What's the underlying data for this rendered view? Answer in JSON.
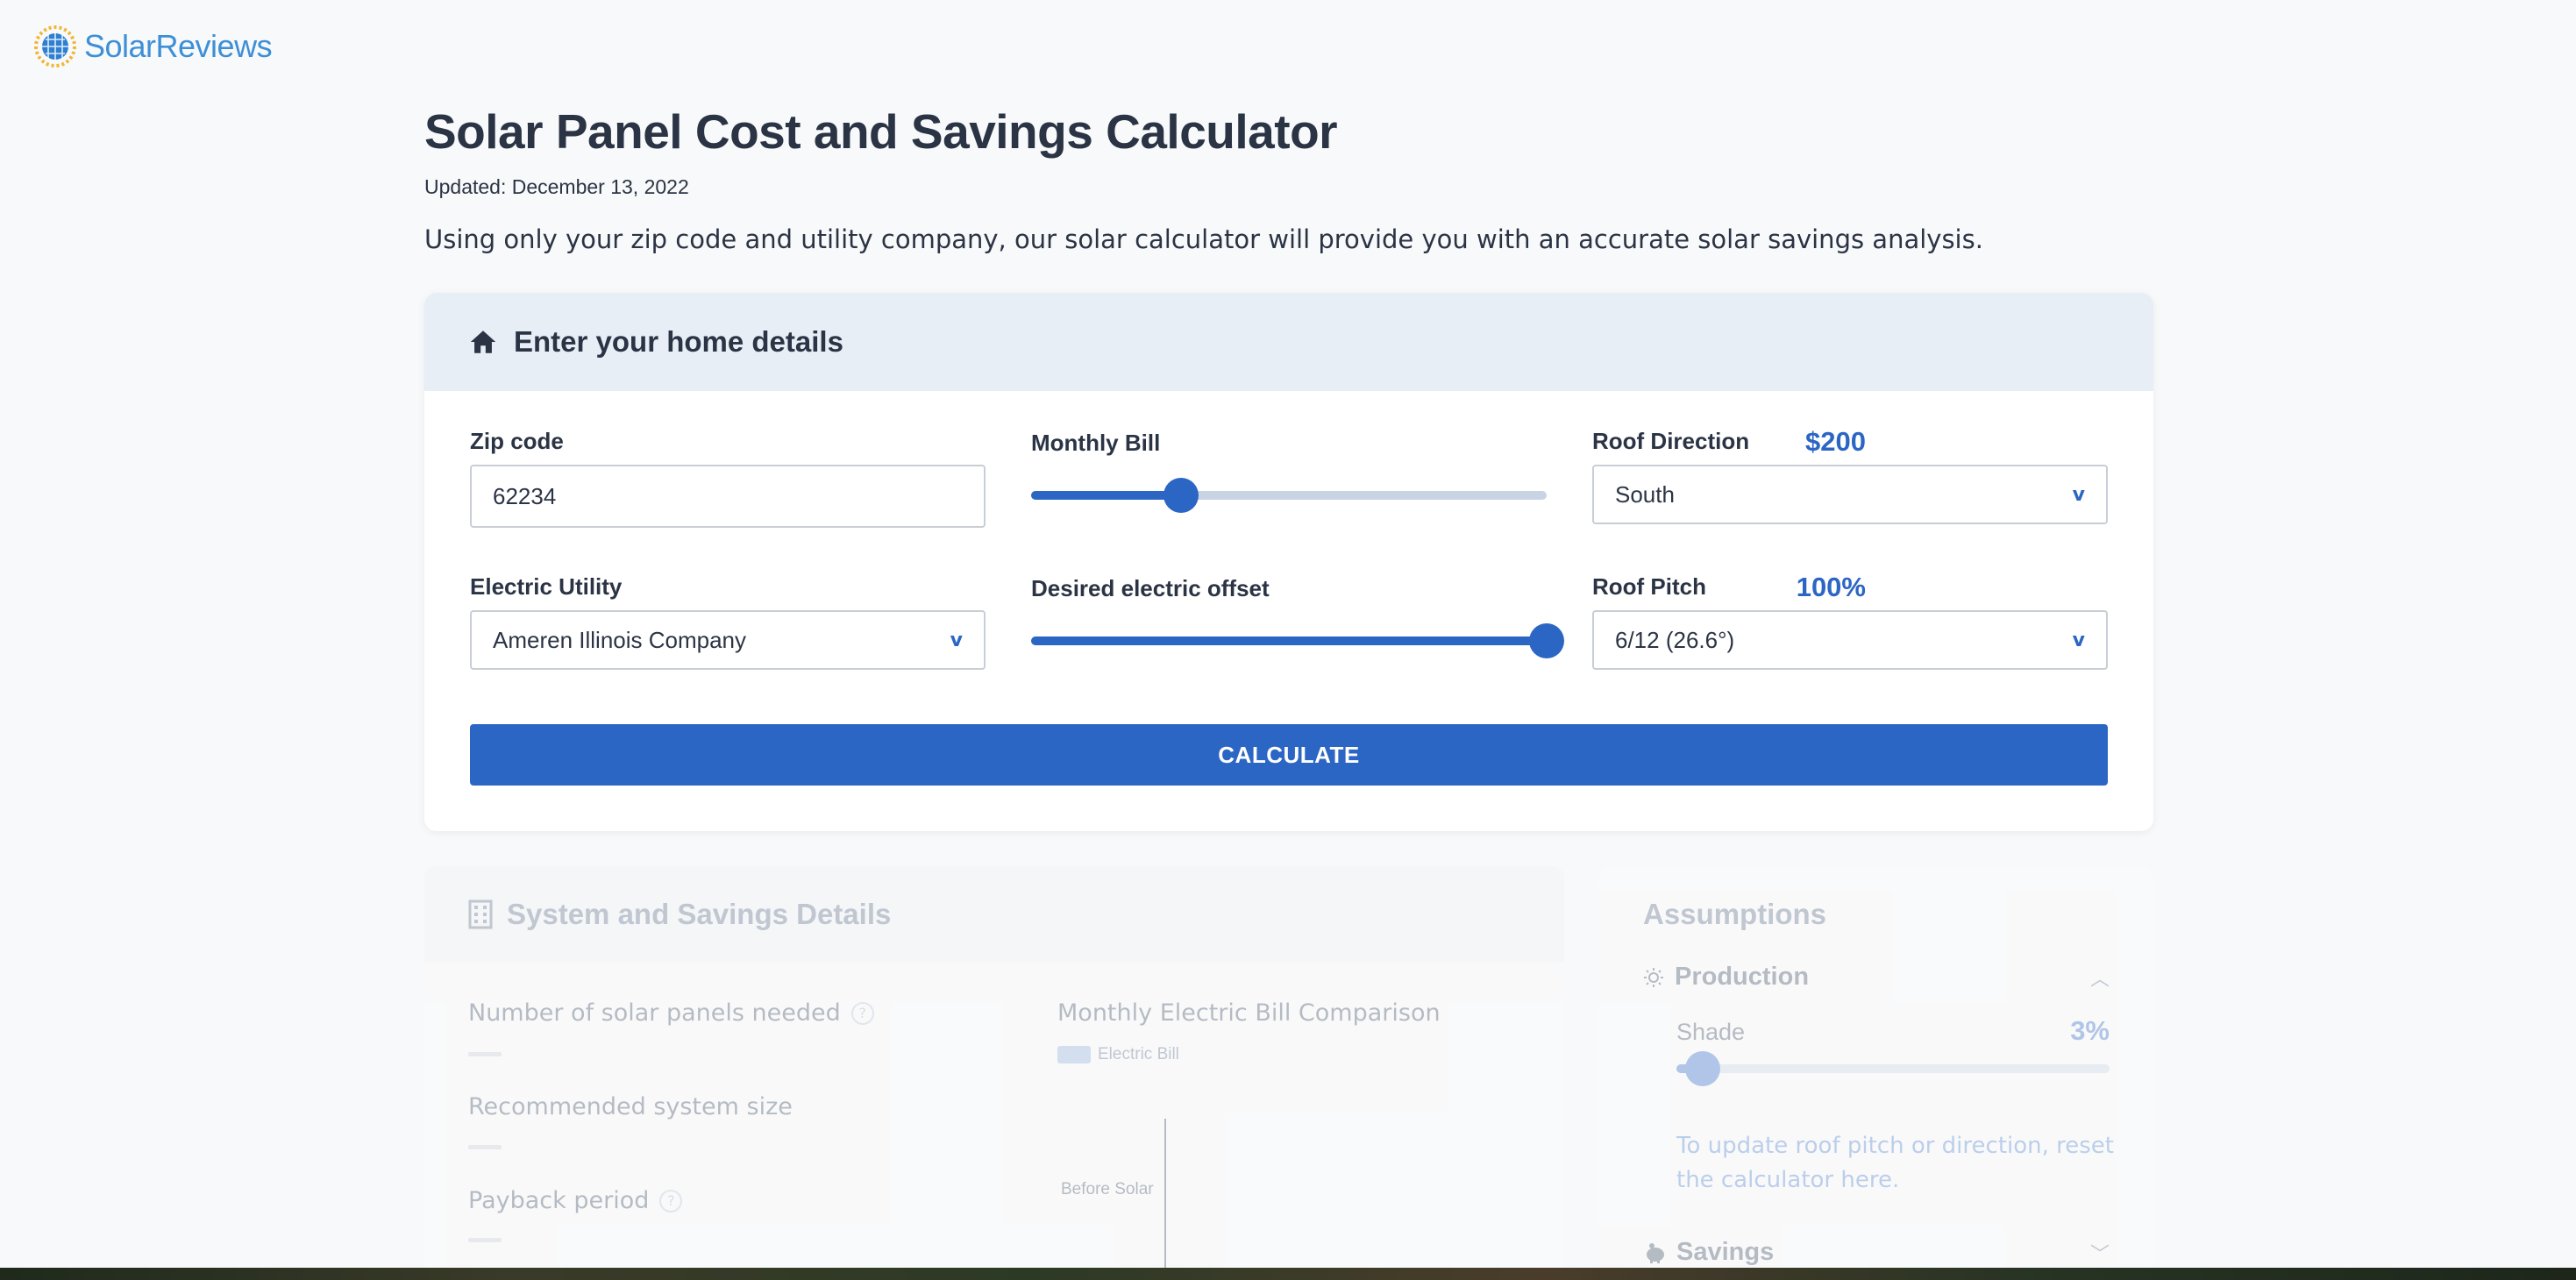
{
  "brand": {
    "name": "SolarReviews",
    "accent": "#2c66c4",
    "logo_color": "#3d8fd8"
  },
  "page": {
    "title": "Solar Panel Cost and Savings Calculator",
    "updated": "Updated: December 13, 2022",
    "intro": "Using only your zip code and utility company, our solar calculator will provide you with an accurate solar savings analysis."
  },
  "home_details": {
    "heading": "Enter your home details",
    "zip": {
      "label": "Zip code",
      "value": "62234"
    },
    "monthly_bill": {
      "label": "Monthly Bill",
      "value_text": "$200",
      "fraction": 0.29
    },
    "roof_direction": {
      "label": "Roof Direction",
      "value": "South"
    },
    "utility": {
      "label": "Electric Utility",
      "value": "Ameren Illinois Company"
    },
    "offset": {
      "label": "Desired electric offset",
      "value_text": "100%",
      "fraction": 1.0
    },
    "roof_pitch": {
      "label": "Roof Pitch",
      "value": "6/12 (26.6°)"
    },
    "calculate_label": "CALCULATE",
    "chevron": "v"
  },
  "results": {
    "heading": "System and Savings Details",
    "stats": [
      {
        "label": "Number of solar panels needed",
        "help": true
      },
      {
        "label": "Recommended system size",
        "help": false
      },
      {
        "label": "Payback period",
        "help": true
      }
    ],
    "help_glyph": "?",
    "chart": {
      "title": "Monthly Electric Bill Comparison",
      "legend": "Electric Bill",
      "category": "Before Solar"
    }
  },
  "assumptions": {
    "heading": "Assumptions",
    "production": {
      "label": "Production",
      "icon": "sun-icon",
      "expanded": true
    },
    "shade": {
      "label": "Shade",
      "value_text": "3%",
      "fraction": 0.06
    },
    "note": "To update roof pitch or direction, reset the calculator here.",
    "savings": {
      "label": "Savings",
      "icon": "piggy-bank-icon",
      "expanded": false
    }
  }
}
